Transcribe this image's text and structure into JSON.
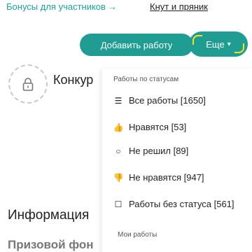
{
  "topbar": {
    "bonus_link": "Бонусы для участников",
    "bonus_arrow": "→",
    "knut_link": "Кнут и пряник"
  },
  "actions": {
    "add_work": "Добавить работу",
    "more": "Еще",
    "more_chevron": "▾"
  },
  "contest": {
    "title": "Конкур",
    "badge_icon": "lock-icon"
  },
  "dropdown": {
    "header": "Работы по статусам",
    "items": [
      {
        "icon": "list-icon",
        "glyph": "☰",
        "label": "Все работы [1650]"
      },
      {
        "icon": "thumbs-up-icon",
        "glyph": "👍",
        "label": "Нравятся [53]"
      },
      {
        "icon": "circle-icon",
        "glyph": "○",
        "label": "Не решил [89]"
      },
      {
        "icon": "thumbs-down-icon",
        "glyph": "👎",
        "label": "Не нравятся [947]"
      },
      {
        "icon": "square-icon",
        "glyph": "☐",
        "label": "Работы без статуса [561]"
      }
    ],
    "footer": "Мои работы"
  },
  "sections": {
    "info_title": "Информация",
    "prize_title": "Призовой фон"
  },
  "colors": {
    "accent": "#1f9d93",
    "link": "#1aa39a",
    "focus": "#f2e21f"
  }
}
